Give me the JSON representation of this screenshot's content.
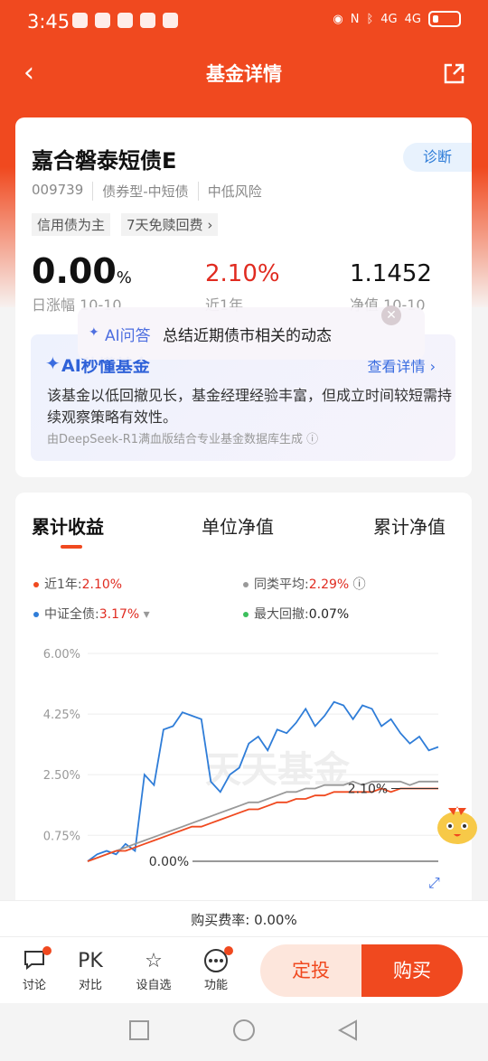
{
  "status": {
    "time": "3:45",
    "net1": "4G",
    "net2": "4G"
  },
  "nav": {
    "title": "基金详情"
  },
  "fund": {
    "name": "嘉合磐泰短债E",
    "diagnose": "诊断",
    "code": "009739",
    "type": "债券型-中短债",
    "risk": "中低风险",
    "tags": [
      "信用债为主",
      "7天免赎回费 ›"
    ],
    "daily_change": "0.00",
    "daily_change_unit": "%",
    "daily_label": "日涨幅 10-10",
    "year_return": "2.10%",
    "year_label": "近1年",
    "nav_value": "1.1452",
    "nav_label": "净值 10-10"
  },
  "ai": {
    "title": "AI秒懂基金",
    "more": "查看详情 ›",
    "body": "该基金以低回撤见长，基金经理经验丰富，但成立时间较短需持续观察策略有效性。",
    "source": "由DeepSeek-R1满血版结合专业基金数据库生成 ⓘ"
  },
  "chart_tabs": [
    "累计收益",
    "单位净值",
    "累计净值"
  ],
  "legend": [
    {
      "name": "近1年:",
      "value": "2.10%",
      "color": "#f0491f"
    },
    {
      "name": "同类平均:",
      "value": "2.29%",
      "color": "#999999",
      "suffix": "ⓘ"
    },
    {
      "name": "中证全债:",
      "value": "3.17%",
      "color": "#2f7dd8",
      "suffix": "▾"
    },
    {
      "name": "最大回撤:",
      "value": "0.07%",
      "color": "#3cbf5c"
    }
  ],
  "chart_data": {
    "type": "line",
    "ylim": [
      0,
      6.0
    ],
    "yticks": [
      "6.00%",
      "4.25%",
      "2.50%",
      "0.75%"
    ],
    "ytick_values": [
      6.0,
      4.25,
      2.5,
      0.75
    ],
    "watermark": "天天基金",
    "annotations": [
      {
        "text": "2.10%",
        "y": 2.1
      },
      {
        "text": "0.00%",
        "y": 0.0
      }
    ],
    "series": [
      {
        "name": "中证全债",
        "color": "#2f7dd8",
        "values": [
          0.0,
          0.2,
          0.3,
          0.2,
          0.5,
          0.3,
          2.5,
          2.2,
          3.8,
          3.9,
          4.3,
          4.2,
          4.1,
          2.3,
          2.0,
          2.5,
          2.7,
          3.4,
          3.6,
          3.2,
          3.8,
          3.7,
          4.0,
          4.4,
          3.9,
          4.2,
          4.6,
          4.5,
          4.1,
          4.5,
          4.4,
          3.9,
          4.1,
          3.7,
          3.4,
          3.6,
          3.2,
          3.3
        ]
      },
      {
        "name": "同类平均",
        "color": "#999999",
        "values": [
          0.0,
          0.1,
          0.2,
          0.3,
          0.4,
          0.5,
          0.6,
          0.7,
          0.8,
          0.9,
          1.0,
          1.1,
          1.2,
          1.3,
          1.4,
          1.5,
          1.6,
          1.7,
          1.7,
          1.8,
          1.9,
          2.0,
          2.0,
          2.1,
          2.1,
          2.2,
          2.2,
          2.2,
          2.3,
          2.2,
          2.3,
          2.3,
          2.3,
          2.3,
          2.2,
          2.3,
          2.3,
          2.3
        ]
      },
      {
        "name": "近1年",
        "color": "#f0491f",
        "values": [
          0.0,
          0.1,
          0.2,
          0.3,
          0.3,
          0.4,
          0.5,
          0.6,
          0.7,
          0.8,
          0.9,
          1.0,
          1.0,
          1.1,
          1.2,
          1.3,
          1.4,
          1.5,
          1.5,
          1.6,
          1.7,
          1.7,
          1.8,
          1.8,
          1.9,
          1.9,
          2.0,
          2.0,
          2.0,
          2.0,
          2.0,
          2.1,
          2.0,
          2.1,
          2.1,
          2.1,
          2.1,
          2.1
        ]
      }
    ]
  },
  "popup": {
    "prefix": "AI问答",
    "question": "总结近期债市相关的动态",
    "close": "✕"
  },
  "fee": {
    "text": "购买费率:  0.00%"
  },
  "bottom": {
    "items": [
      {
        "label": "讨论",
        "glyph": "💬"
      },
      {
        "label": "对比",
        "glyph": "PK"
      },
      {
        "label": "设自选",
        "glyph": "☆"
      },
      {
        "label": "功能",
        "glyph": "⋯"
      }
    ],
    "fixed_invest": "定投",
    "buy": "购买"
  }
}
